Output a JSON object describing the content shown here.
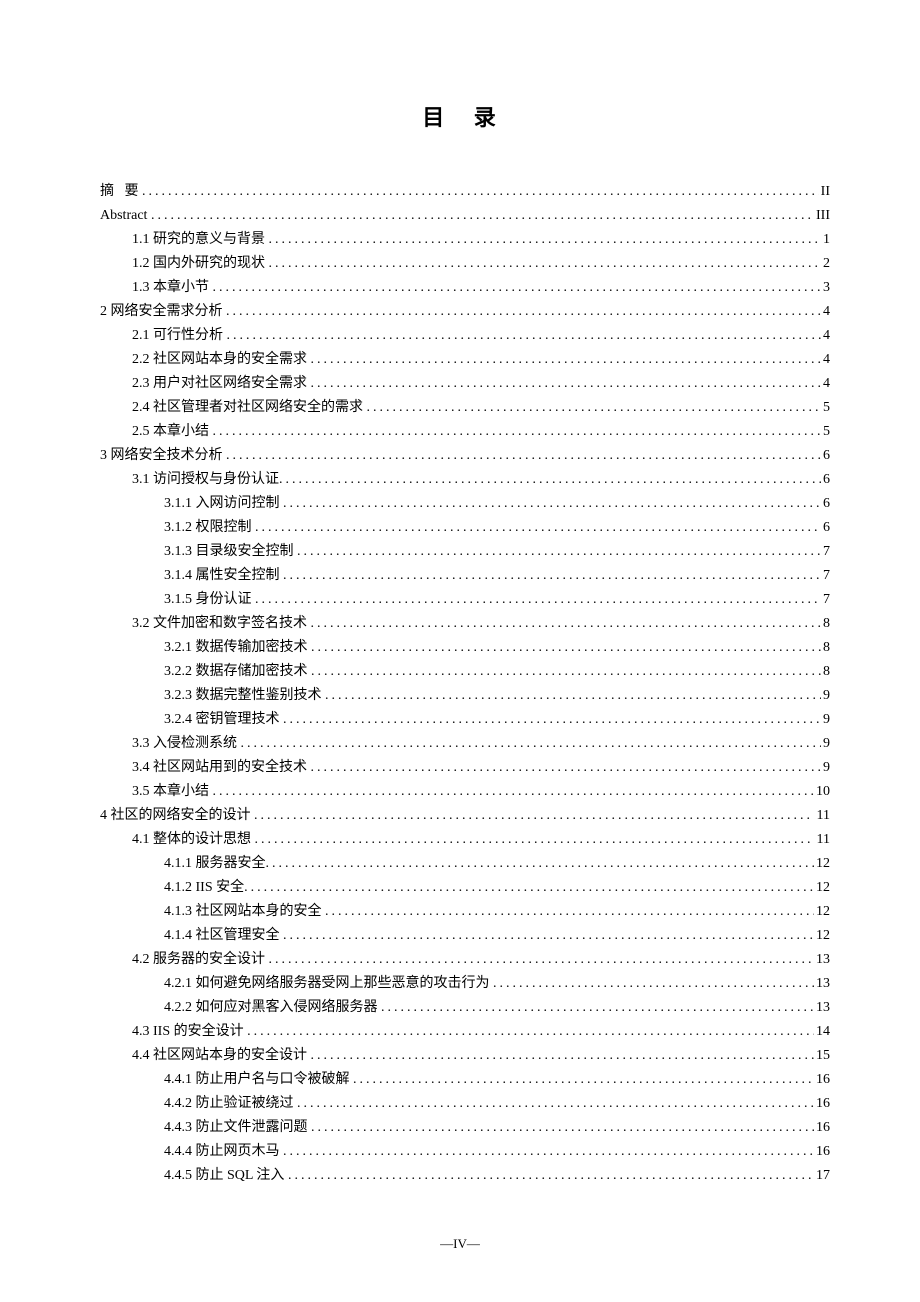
{
  "title": "目 录",
  "page_number": "—IV—",
  "toc": [
    {
      "indent": 0,
      "label": "摘   要 ",
      "page": "II"
    },
    {
      "indent": 0,
      "label": "Abstract ",
      "page": " III"
    },
    {
      "indent": 1,
      "label": "1.1 研究的意义与背景 ",
      "page": "1"
    },
    {
      "indent": 1,
      "label": "1.2 国内外研究的现状 ",
      "page": "2"
    },
    {
      "indent": 1,
      "label": "1.3 本章小节 ",
      "page": "3"
    },
    {
      "indent": 0,
      "label": "2 网络安全需求分析 ",
      "page": "4"
    },
    {
      "indent": 1,
      "label": "2.1 可行性分析 ",
      "page": "4"
    },
    {
      "indent": 1,
      "label": "2.2 社区网站本身的安全需求 ",
      "page": "4"
    },
    {
      "indent": 1,
      "label": "2.3 用户对社区网络安全需求 ",
      "page": "4"
    },
    {
      "indent": 1,
      "label": "2.4 社区管理者对社区网络安全的需求 ",
      "page": "5"
    },
    {
      "indent": 1,
      "label": "2.5 本章小结 ",
      "page": "5"
    },
    {
      "indent": 0,
      "label": "3 网络安全技术分析 ",
      "page": "6"
    },
    {
      "indent": 1,
      "label": "3.1 访问授权与身份认证",
      "page": "6"
    },
    {
      "indent": 2,
      "label": "3.1.1 入网访问控制 ",
      "page": "6"
    },
    {
      "indent": 2,
      "label": "3.1.2 权限控制 ",
      "page": "6"
    },
    {
      "indent": 2,
      "label": "3.1.3 目录级安全控制 ",
      "page": "7"
    },
    {
      "indent": 2,
      "label": "3.1.4 属性安全控制 ",
      "page": "7"
    },
    {
      "indent": 2,
      "label": "3.1.5 身份认证 ",
      "page": "7"
    },
    {
      "indent": 1,
      "label": "3.2 文件加密和数字签名技术 ",
      "page": "8"
    },
    {
      "indent": 2,
      "label": "3.2.1 数据传输加密技术 ",
      "page": "8"
    },
    {
      "indent": 2,
      "label": "3.2.2 数据存储加密技术 ",
      "page": "8"
    },
    {
      "indent": 2,
      "label": "3.2.3 数据完整性鉴别技术 ",
      "page": "9"
    },
    {
      "indent": 2,
      "label": "3.2.4 密钥管理技术 ",
      "page": "9"
    },
    {
      "indent": 1,
      "label": "3.3 入侵检测系统 ",
      "page": "9"
    },
    {
      "indent": 1,
      "label": "3.4 社区网站用到的安全技术 ",
      "page": "9"
    },
    {
      "indent": 1,
      "label": "3.5 本章小结 ",
      "page": "10"
    },
    {
      "indent": 0,
      "label": "4 社区的网络安全的设计 ",
      "page": " 11"
    },
    {
      "indent": 1,
      "label": "4.1 整体的设计思想 ",
      "page": " 11"
    },
    {
      "indent": 2,
      "label": "4.1.1 服务器安全",
      "page": "12"
    },
    {
      "indent": 2,
      "label": "4.1.2 IIS 安全",
      "page": "12"
    },
    {
      "indent": 2,
      "label": "4.1.3 社区网站本身的安全 ",
      "page": "12"
    },
    {
      "indent": 2,
      "label": "4.1.4 社区管理安全 ",
      "page": "12"
    },
    {
      "indent": 1,
      "label": "4.2 服务器的安全设计 ",
      "page": "13"
    },
    {
      "indent": 2,
      "label": "4.2.1 如何避免网络服务器受网上那些恶意的攻击行为 ",
      "page": "13"
    },
    {
      "indent": 2,
      "label": "4.2.2 如何应对黑客入侵网络服务器 ",
      "page": "13"
    },
    {
      "indent": 1,
      "label": "4.3 IIS 的安全设计 ",
      "page": "14"
    },
    {
      "indent": 1,
      "label": "4.4 社区网站本身的安全设计 ",
      "page": "15"
    },
    {
      "indent": 2,
      "label": "4.4.1 防止用户名与口令被破解 ",
      "page": "16"
    },
    {
      "indent": 2,
      "label": "4.4.2 防止验证被绕过 ",
      "page": "16"
    },
    {
      "indent": 2,
      "label": "4.4.3 防止文件泄露问题 ",
      "page": "16"
    },
    {
      "indent": 2,
      "label": "4.4.4 防止网页木马 ",
      "page": "16"
    },
    {
      "indent": 2,
      "label": "4.4.5 防止 SQL 注入 ",
      "page": "17"
    }
  ]
}
